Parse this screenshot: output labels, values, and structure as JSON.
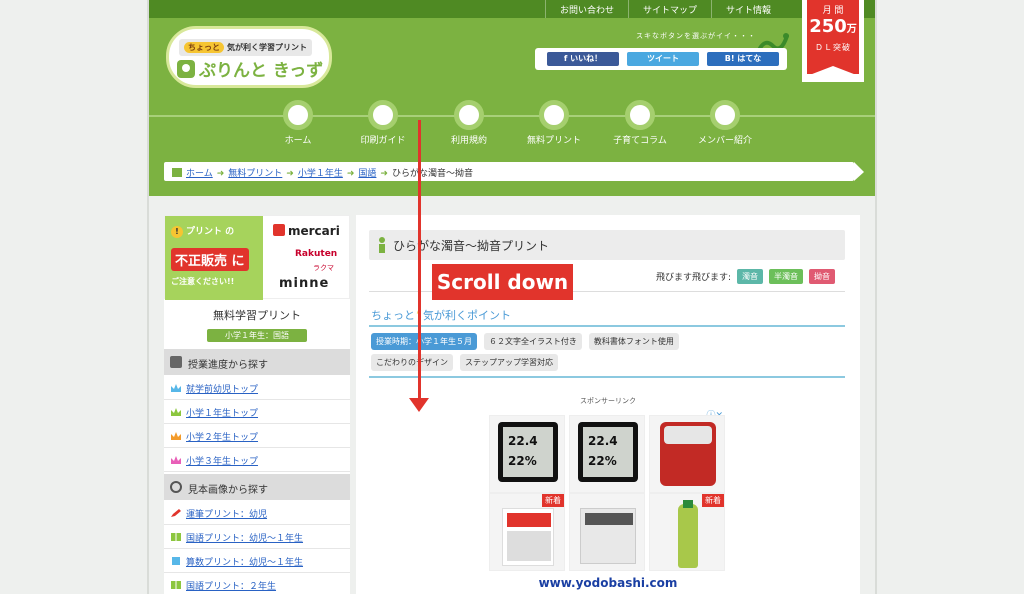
{
  "topbar": {
    "links": [
      "お問い合わせ",
      "サイトマップ",
      "サイト情報"
    ]
  },
  "logo": {
    "tagline_chip": "ちょっと",
    "tagline": "気が利く学習プリント",
    "name": "ぷりんと きっず"
  },
  "share": {
    "caption": "スキなボタンを選ぶがイイ・・・",
    "buttons": [
      "f いいね！",
      "ツイート",
      "B! はてな"
    ]
  },
  "ribbon": {
    "line1": "月 間",
    "number": "250",
    "unit": "万",
    "line3": "ＤＬ突破"
  },
  "nav": [
    "ホーム",
    "印刷ガイド",
    "利用規約",
    "無料プリント",
    "子育てコラム",
    "メンバー紹介"
  ],
  "breadcrumb": {
    "items": [
      "ホーム",
      "無料プリント",
      "小学１年生",
      "国語"
    ],
    "current": "ひらがな濁音〜拗音"
  },
  "sidebar": {
    "banner": {
      "line1": "プリント の",
      "line2": "不正販売 に",
      "line3": "ご注意ください!!",
      "brand1": "mercari",
      "brand2": "Rakuten",
      "brand2_sub": "ラクマ",
      "brand3": "minne"
    },
    "title": "無料学習プリント",
    "subtitle": "小学１年生：国語",
    "section1": "授業進度から探す",
    "links1": [
      "就学前幼児トップ",
      "小学１年生トップ",
      "小学２年生トップ",
      "小学３年生トップ"
    ],
    "section2": "見本画像から探す",
    "links2": [
      "運筆プリント：幼児",
      "国語プリント：幼児〜１年生",
      "算数プリント：幼児〜１年生",
      "国語プリント：２年生"
    ]
  },
  "main": {
    "title": "ひらがな濁音〜拗音プリント",
    "jump_label": "飛びます飛びます:",
    "jump_buttons": [
      "濁音",
      "半濁音",
      "拗音"
    ],
    "point_prefix": "ちょっと",
    "point_title": "気が利くポイント",
    "tags_row1": [
      "授業時期：小学１年生５月",
      "６２文字全イラスト付き",
      "教科書体フォント使用"
    ],
    "tags_row2": [
      "こだわりのデザイン",
      "ステップアップ学習対応"
    ],
    "sponsor": "スポンサーリンク",
    "ad": {
      "info": "ⓘ✕",
      "thermo1": "22.4 22%",
      "thermo2": "22.4 22%",
      "new": "新着",
      "footer": "www.yodobashi.com"
    }
  },
  "overlay": {
    "label": "Scroll down"
  },
  "colors": {
    "green": "#7cb241",
    "dark_green": "#4f8a23",
    "red": "#e1342c",
    "link": "#2962c4",
    "accent_blue": "#4a9ad6"
  }
}
